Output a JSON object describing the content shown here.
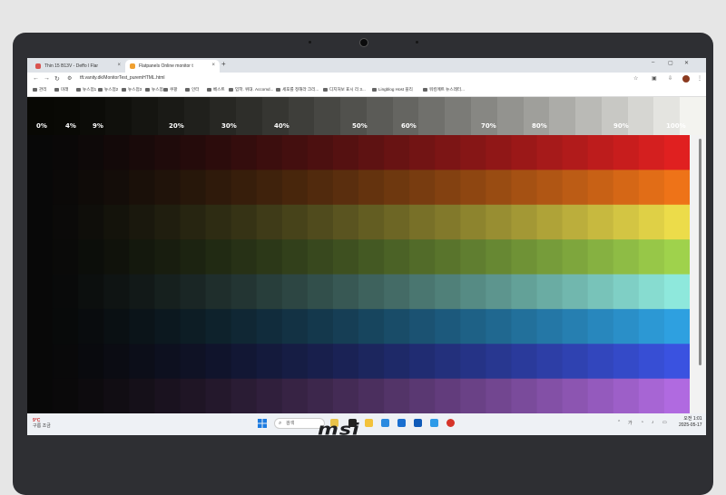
{
  "browser": {
    "tabs": [
      {
        "label": "Thin 15 B13V - Deffo l Flar",
        "icon_color": "#d9534f"
      },
      {
        "label": "Flatpanels Online monitor t",
        "icon_color": "#f0a030"
      }
    ],
    "new_tab_label": "+",
    "close_glyph": "×",
    "window_controls": [
      "–",
      "▢",
      "✕"
    ],
    "url": "tft.vanity.dk/MonitorTest_puremHTML.html",
    "bookmarks": [
      "관리",
      "미래",
      "뉴스점1",
      "뉴스점2",
      "뉴스점3",
      "뉴스점4",
      "쿠팡",
      "인터",
      "베스트",
      "입학. 위대. Accomd...",
      "세포를 정해라 크리...",
      "디지처보 표시 리 3...",
      "Lingblog Host 블리",
      "워킹메트 뉴스레터..."
    ]
  },
  "monitor_test": {
    "percent_labels": [
      "0%",
      "4%",
      "9%",
      "20%",
      "30%",
      "40%",
      "50%",
      "60%",
      "70%",
      "80%",
      "90%",
      "100%"
    ],
    "gray_steps": 26,
    "gradient_columns": 26,
    "bands": [
      {
        "name": "red",
        "color": "#e02020"
      },
      {
        "name": "orange",
        "color": "#ee7318"
      },
      {
        "name": "yellow",
        "color": "#ecdc4a"
      },
      {
        "name": "lime",
        "color": "#9fd24c"
      },
      {
        "name": "aqua",
        "color": "#8ee8dc"
      },
      {
        "name": "sky",
        "color": "#2ea0e0"
      },
      {
        "name": "blue",
        "color": "#3a52e0"
      },
      {
        "name": "violet",
        "color": "#b06ae0"
      }
    ]
  },
  "taskbar": {
    "weather_temp": "9°C",
    "weather_desc": "구름 조금",
    "search_placeholder": "검색",
    "lang_indicator": "가",
    "time": "오전 1:01",
    "date": "2025-05-17"
  },
  "laptop": {
    "brand": "msi"
  }
}
